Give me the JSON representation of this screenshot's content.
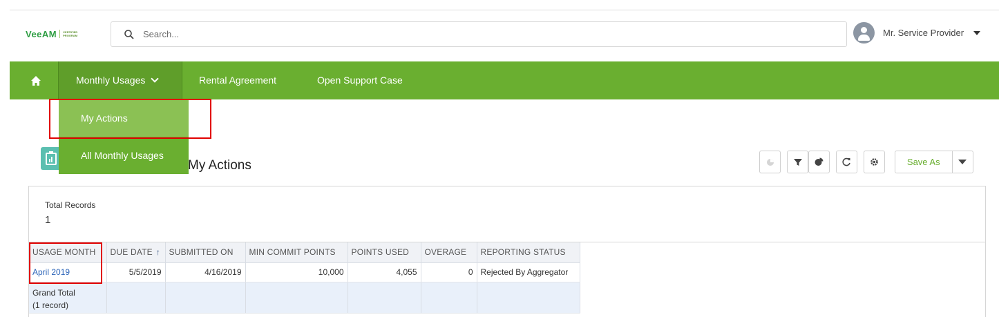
{
  "header": {
    "logo_brand": "VeeAM",
    "logo_program_line1": "CERTIFIED",
    "logo_program_line2": "PROGRAM",
    "search_placeholder": "Search...",
    "user_name": "Mr. Service Provider"
  },
  "nav": {
    "items": [
      {
        "label": "Monthly Usages"
      },
      {
        "label": "Rental Agreement"
      },
      {
        "label": "Open Support Case"
      }
    ],
    "dropdown": [
      {
        "label": "My Actions"
      },
      {
        "label": "All Monthly Usages"
      }
    ]
  },
  "page": {
    "title": "My Actions",
    "save_as_label": "Save As",
    "total_records_label": "Total Records",
    "total_records_value": "1"
  },
  "table": {
    "columns": [
      "USAGE MONTH",
      "DUE DATE",
      "SUBMITTED ON",
      "MIN COMMIT POINTS",
      "POINTS USED",
      "OVERAGE",
      "REPORTING STATUS"
    ],
    "rows": [
      {
        "usage_month": "April 2019",
        "due_date": "5/5/2019",
        "submitted_on": "4/16/2019",
        "min_commit_points": "10,000",
        "points_used": "4,055",
        "overage": "0",
        "reporting_status": "Rejected By Aggregator"
      }
    ],
    "grand_total_line1": "Grand Total",
    "grand_total_line2": "(1 record)"
  },
  "colors": {
    "brand_green": "#6aaf30",
    "highlight_red": "#e10000",
    "link_blue": "#2a63b8"
  },
  "icons": [
    "search-icon",
    "home-icon",
    "chevron-down-icon",
    "chart-icon",
    "filter-icon",
    "pie-chart-icon",
    "refresh-icon",
    "gear-icon",
    "caret-down-icon",
    "report-icon",
    "sort-ascending-icon"
  ]
}
